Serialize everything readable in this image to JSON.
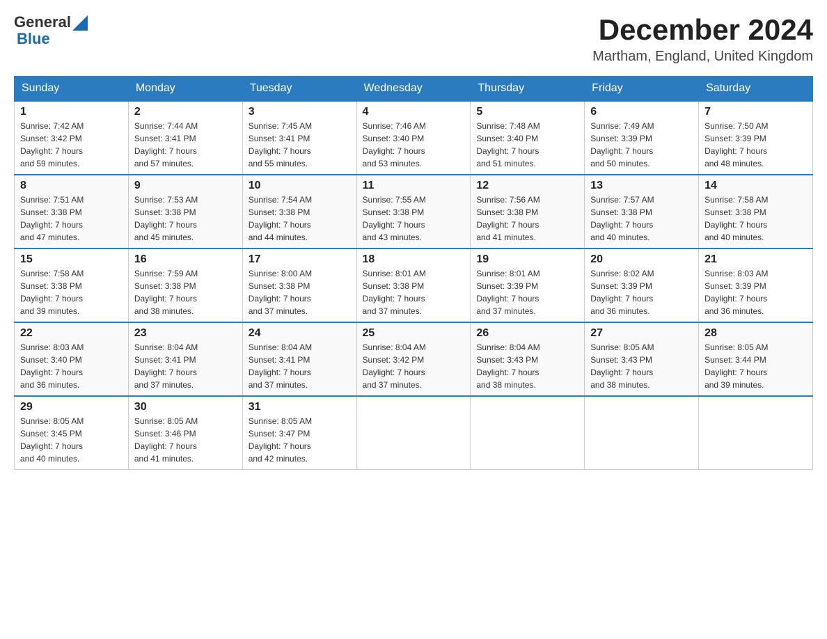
{
  "header": {
    "logo": {
      "text1": "General",
      "text2": "Blue"
    },
    "title": "December 2024",
    "location": "Martham, England, United Kingdom"
  },
  "days_of_week": [
    "Sunday",
    "Monday",
    "Tuesday",
    "Wednesday",
    "Thursday",
    "Friday",
    "Saturday"
  ],
  "weeks": [
    [
      {
        "day": "1",
        "sunrise": "7:42 AM",
        "sunset": "3:42 PM",
        "daylight": "7 hours and 59 minutes."
      },
      {
        "day": "2",
        "sunrise": "7:44 AM",
        "sunset": "3:41 PM",
        "daylight": "7 hours and 57 minutes."
      },
      {
        "day": "3",
        "sunrise": "7:45 AM",
        "sunset": "3:41 PM",
        "daylight": "7 hours and 55 minutes."
      },
      {
        "day": "4",
        "sunrise": "7:46 AM",
        "sunset": "3:40 PM",
        "daylight": "7 hours and 53 minutes."
      },
      {
        "day": "5",
        "sunrise": "7:48 AM",
        "sunset": "3:40 PM",
        "daylight": "7 hours and 51 minutes."
      },
      {
        "day": "6",
        "sunrise": "7:49 AM",
        "sunset": "3:39 PM",
        "daylight": "7 hours and 50 minutes."
      },
      {
        "day": "7",
        "sunrise": "7:50 AM",
        "sunset": "3:39 PM",
        "daylight": "7 hours and 48 minutes."
      }
    ],
    [
      {
        "day": "8",
        "sunrise": "7:51 AM",
        "sunset": "3:38 PM",
        "daylight": "7 hours and 47 minutes."
      },
      {
        "day": "9",
        "sunrise": "7:53 AM",
        "sunset": "3:38 PM",
        "daylight": "7 hours and 45 minutes."
      },
      {
        "day": "10",
        "sunrise": "7:54 AM",
        "sunset": "3:38 PM",
        "daylight": "7 hours and 44 minutes."
      },
      {
        "day": "11",
        "sunrise": "7:55 AM",
        "sunset": "3:38 PM",
        "daylight": "7 hours and 43 minutes."
      },
      {
        "day": "12",
        "sunrise": "7:56 AM",
        "sunset": "3:38 PM",
        "daylight": "7 hours and 41 minutes."
      },
      {
        "day": "13",
        "sunrise": "7:57 AM",
        "sunset": "3:38 PM",
        "daylight": "7 hours and 40 minutes."
      },
      {
        "day": "14",
        "sunrise": "7:58 AM",
        "sunset": "3:38 PM",
        "daylight": "7 hours and 40 minutes."
      }
    ],
    [
      {
        "day": "15",
        "sunrise": "7:58 AM",
        "sunset": "3:38 PM",
        "daylight": "7 hours and 39 minutes."
      },
      {
        "day": "16",
        "sunrise": "7:59 AM",
        "sunset": "3:38 PM",
        "daylight": "7 hours and 38 minutes."
      },
      {
        "day": "17",
        "sunrise": "8:00 AM",
        "sunset": "3:38 PM",
        "daylight": "7 hours and 37 minutes."
      },
      {
        "day": "18",
        "sunrise": "8:01 AM",
        "sunset": "3:38 PM",
        "daylight": "7 hours and 37 minutes."
      },
      {
        "day": "19",
        "sunrise": "8:01 AM",
        "sunset": "3:39 PM",
        "daylight": "7 hours and 37 minutes."
      },
      {
        "day": "20",
        "sunrise": "8:02 AM",
        "sunset": "3:39 PM",
        "daylight": "7 hours and 36 minutes."
      },
      {
        "day": "21",
        "sunrise": "8:03 AM",
        "sunset": "3:39 PM",
        "daylight": "7 hours and 36 minutes."
      }
    ],
    [
      {
        "day": "22",
        "sunrise": "8:03 AM",
        "sunset": "3:40 PM",
        "daylight": "7 hours and 36 minutes."
      },
      {
        "day": "23",
        "sunrise": "8:04 AM",
        "sunset": "3:41 PM",
        "daylight": "7 hours and 37 minutes."
      },
      {
        "day": "24",
        "sunrise": "8:04 AM",
        "sunset": "3:41 PM",
        "daylight": "7 hours and 37 minutes."
      },
      {
        "day": "25",
        "sunrise": "8:04 AM",
        "sunset": "3:42 PM",
        "daylight": "7 hours and 37 minutes."
      },
      {
        "day": "26",
        "sunrise": "8:04 AM",
        "sunset": "3:43 PM",
        "daylight": "7 hours and 38 minutes."
      },
      {
        "day": "27",
        "sunrise": "8:05 AM",
        "sunset": "3:43 PM",
        "daylight": "7 hours and 38 minutes."
      },
      {
        "day": "28",
        "sunrise": "8:05 AM",
        "sunset": "3:44 PM",
        "daylight": "7 hours and 39 minutes."
      }
    ],
    [
      {
        "day": "29",
        "sunrise": "8:05 AM",
        "sunset": "3:45 PM",
        "daylight": "7 hours and 40 minutes."
      },
      {
        "day": "30",
        "sunrise": "8:05 AM",
        "sunset": "3:46 PM",
        "daylight": "7 hours and 41 minutes."
      },
      {
        "day": "31",
        "sunrise": "8:05 AM",
        "sunset": "3:47 PM",
        "daylight": "7 hours and 42 minutes."
      },
      null,
      null,
      null,
      null
    ]
  ]
}
